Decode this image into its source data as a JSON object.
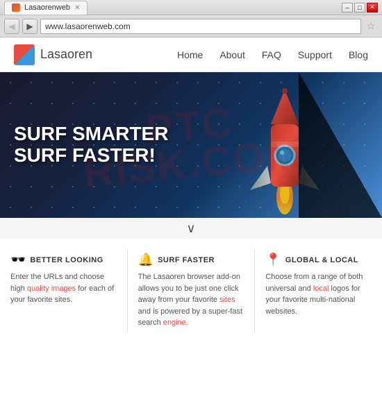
{
  "window": {
    "title": "Lasaorenweb",
    "tab_label": "Lasaorenweb",
    "url": "www.lasaorenweb.com",
    "controls": {
      "minimize": "–",
      "maximize": "□",
      "close": "✕"
    }
  },
  "browser": {
    "back_btn": "◀",
    "forward_btn": "▶",
    "url_placeholder": "www.lasaorenweb.com"
  },
  "nav": {
    "logo_text": "Lasaoren",
    "links": [
      {
        "label": "Home",
        "id": "home"
      },
      {
        "label": "About",
        "id": "about"
      },
      {
        "label": "FAQ",
        "id": "faq"
      },
      {
        "label": "Support",
        "id": "support"
      },
      {
        "label": "Blog",
        "id": "blog"
      }
    ]
  },
  "hero": {
    "line1": "SURF SMARTER",
    "line2": "SURF FASTER!"
  },
  "watermark": {
    "line1": "PTC",
    "line2": "RISK.COM"
  },
  "features": [
    {
      "id": "better-looking",
      "title": "BETTER LOOKING",
      "icon": "👓",
      "text_before_link1": "Enter the URLs and choose high ",
      "link1_text": "quality images",
      "text_after_link1": " for each of your favorite sites.",
      "link2_text": null
    },
    {
      "id": "surf-faster",
      "title": "SURF FASTER",
      "icon": "🔔",
      "text_before_link1": "The Lasaoren browser add-on allows you to be just one click away from your favorite ",
      "link1_text": "sites",
      "text_mid": " and is powered by a super-fast search ",
      "link2_text": "engine",
      "text_after": "."
    },
    {
      "id": "global-local",
      "title": "GLOBAL & LOCAL",
      "icon": "📍",
      "text_before_link1": "Choose from a range of both universal and ",
      "link1_text": "local",
      "text_after_link1": " logos for your favorite multi-national websites.",
      "link2_text": null
    }
  ]
}
